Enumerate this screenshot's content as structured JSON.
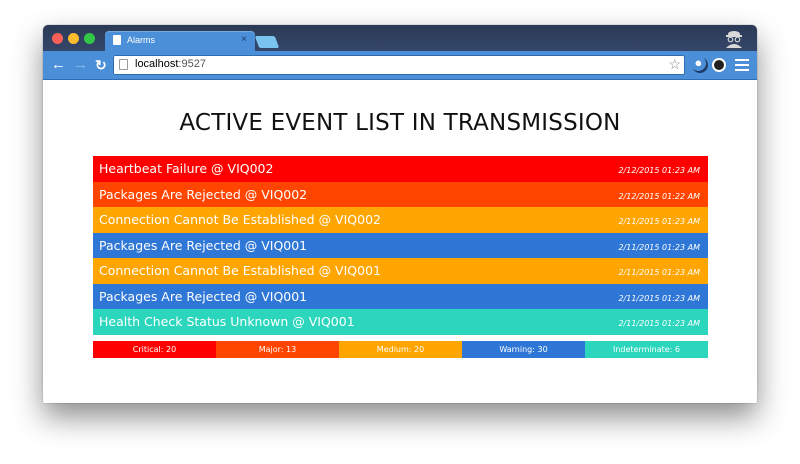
{
  "browser": {
    "tab_title": "Alarms",
    "tab_close": "×",
    "url_host": "localhost",
    "url_port": ":9527"
  },
  "page": {
    "title": "ACTIVE EVENT LIST IN TRANSMISSION"
  },
  "colors": {
    "critical": "#ff0000",
    "major": "#ff4500",
    "medium": "#ffa500",
    "warning": "#2f77d6",
    "indeterminate": "#2bd6bd"
  },
  "events": [
    {
      "name": "Heartbeat Failure @ VIQ002",
      "time": "2/12/2015 01:23 AM",
      "severity": "critical"
    },
    {
      "name": "Packages Are Rejected @ VIQ002",
      "time": "2/12/2015 01:22 AM",
      "severity": "major"
    },
    {
      "name": "Connection Cannot Be Established @ VIQ002",
      "time": "2/11/2015 01:23 AM",
      "severity": "medium"
    },
    {
      "name": "Packages Are Rejected @ VIQ001",
      "time": "2/11/2015 01:23 AM",
      "severity": "warning"
    },
    {
      "name": "Connection Cannot Be Established @ VIQ001",
      "time": "2/11/2015 01:23 AM",
      "severity": "medium"
    },
    {
      "name": "Packages Are Rejected @ VIQ001",
      "time": "2/11/2015 01:23 AM",
      "severity": "warning"
    },
    {
      "name": "Health Check Status Unknown @ VIQ001",
      "time": "2/11/2015 01:23 AM",
      "severity": "indeterminate"
    }
  ],
  "summary": [
    {
      "label": "Critical: 20",
      "severity": "critical"
    },
    {
      "label": "Major: 13",
      "severity": "major"
    },
    {
      "label": "Medium: 20",
      "severity": "medium"
    },
    {
      "label": "Warning: 30",
      "severity": "warning"
    },
    {
      "label": "Indeterminate: 6",
      "severity": "indeterminate"
    }
  ]
}
